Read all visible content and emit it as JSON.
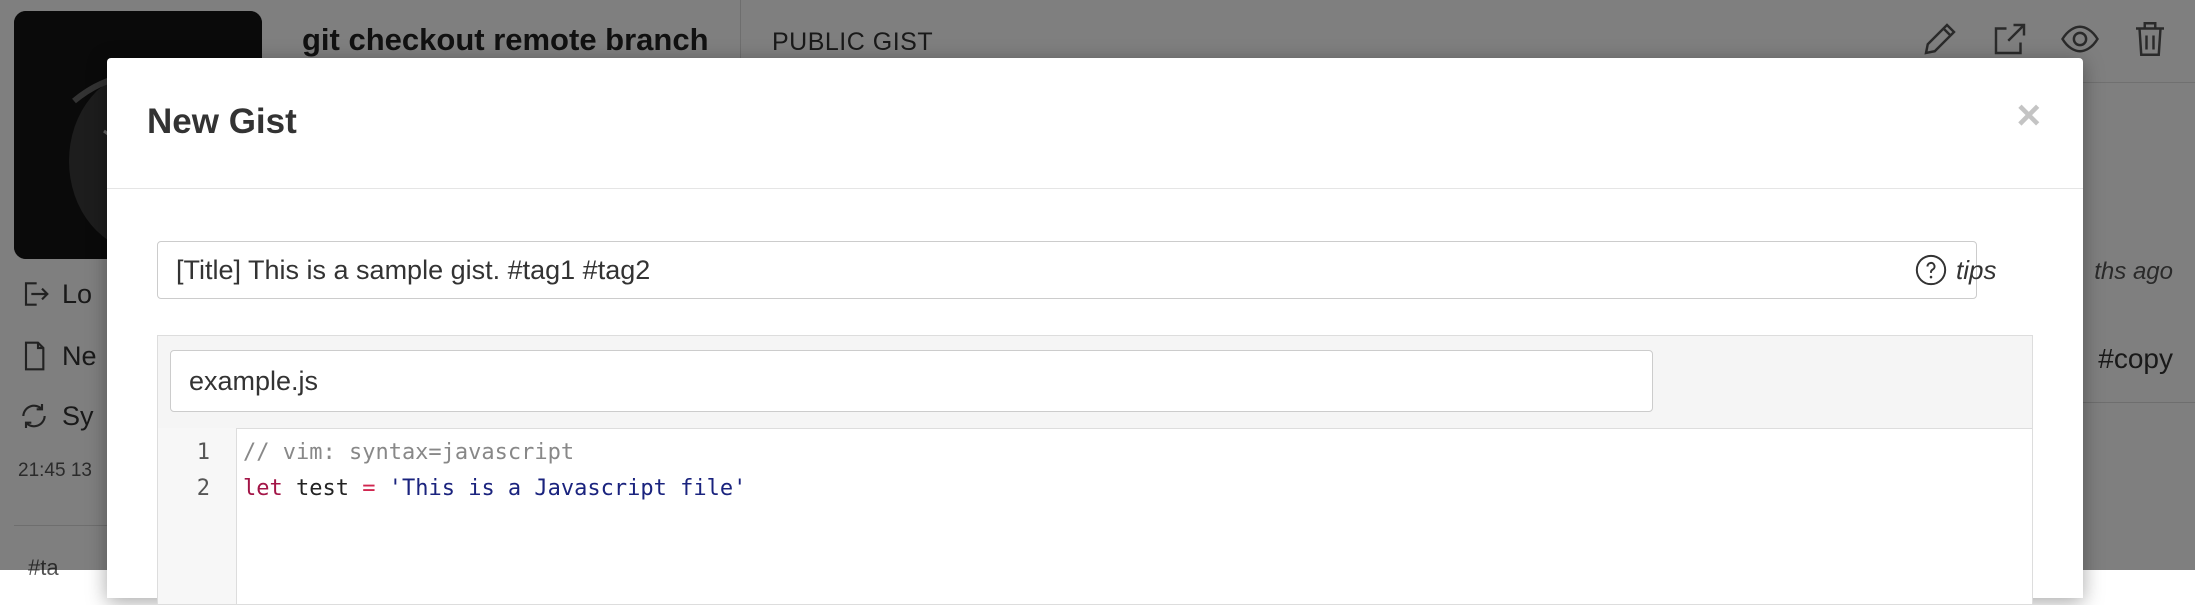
{
  "sidebar": {
    "items": [
      {
        "label": "Lo",
        "icon": "logout-icon"
      },
      {
        "label": "Ne",
        "icon": "new-file-icon"
      },
      {
        "label": "Sy",
        "icon": "sync-icon"
      }
    ],
    "timestamp": "21:45 13",
    "partial_tag": "#ta"
  },
  "gist_header": {
    "title": "git checkout remote branch",
    "visibility": "PUBLIC GIST",
    "actions": [
      "pencil-icon",
      "open-external-icon",
      "eye-icon",
      "trash-icon"
    ]
  },
  "background_right": {
    "meta": "ths ago",
    "tag": "#copy"
  },
  "modal": {
    "title": "New Gist",
    "close_label": "×",
    "title_input_value": "[Title] This is a sample gist. #tag1 #tag2",
    "tips_label": "tips",
    "file": {
      "filename": "example.js",
      "lines": [
        {
          "number": "1",
          "text": "// vim: syntax=javascript"
        },
        {
          "number": "2",
          "text": "let test = 'This is a Javascript file'"
        }
      ],
      "line2_tokens": {
        "kw": "let",
        "id": " test ",
        "op": "=",
        "str": " 'This is a Javascript file'"
      }
    }
  },
  "colors": {
    "overlay": "rgba(0,0,0,0.5)",
    "comment": "#888888",
    "keyword": "#a31547",
    "string": "#1a237e"
  }
}
